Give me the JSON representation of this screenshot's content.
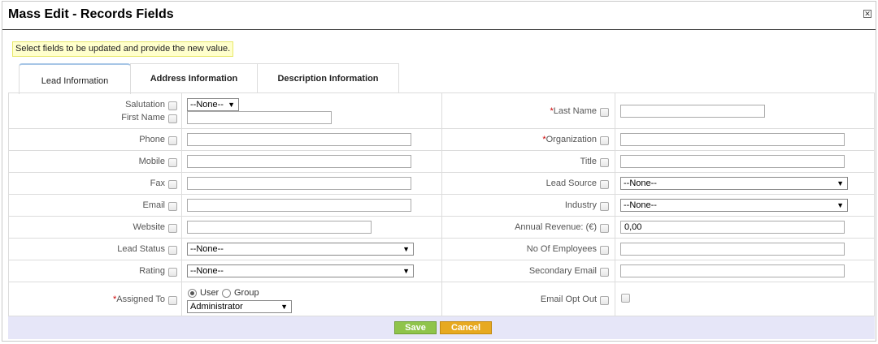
{
  "dialog": {
    "title": "Mass Edit - Records Fields",
    "close_glyph": "✕",
    "hint": "Select fields to be updated and provide the new value."
  },
  "tabs": [
    {
      "label": "Lead Information",
      "active": true
    },
    {
      "label": "Address Information",
      "active": false
    },
    {
      "label": "Description Information",
      "active": false
    }
  ],
  "left_fields": {
    "salutation": {
      "label": "Salutation",
      "value": "--None--"
    },
    "first_name": {
      "label": "First Name",
      "value": ""
    },
    "phone": {
      "label": "Phone",
      "value": ""
    },
    "mobile": {
      "label": "Mobile",
      "value": ""
    },
    "fax": {
      "label": "Fax",
      "value": ""
    },
    "email": {
      "label": "Email",
      "value": ""
    },
    "website": {
      "label": "Website",
      "value": ""
    },
    "lead_status": {
      "label": "Lead Status",
      "value": "--None--"
    },
    "rating": {
      "label": "Rating",
      "value": "--None--"
    },
    "assigned_to": {
      "required_mark": "*",
      "label": "Assigned To",
      "option_user": "User",
      "option_group": "Group",
      "selected_option": "User",
      "value": "Administrator"
    }
  },
  "right_fields": {
    "last_name": {
      "required_mark": "*",
      "label": "Last Name",
      "value": ""
    },
    "organization": {
      "required_mark": "*",
      "label": "Organization",
      "value": ""
    },
    "title": {
      "label": "Title",
      "value": ""
    },
    "lead_source": {
      "label": "Lead Source",
      "value": "--None--"
    },
    "industry": {
      "label": "Industry",
      "value": "--None--"
    },
    "annual_revenue": {
      "label": "Annual Revenue: (€)",
      "value": "0,00"
    },
    "no_of_employees": {
      "label": "No Of Employees",
      "value": ""
    },
    "secondary_email": {
      "label": "Secondary Email",
      "value": ""
    },
    "email_opt_out": {
      "label": "Email Opt Out",
      "checked": false
    }
  },
  "footer": {
    "save_label": "Save",
    "cancel_label": "Cancel"
  },
  "colors": {
    "hint_bg": "#ffffcc",
    "footer_bg": "#e6e6f8",
    "save_bg": "#8fc44b",
    "cancel_bg": "#e7a920",
    "required": "#cc0000"
  }
}
